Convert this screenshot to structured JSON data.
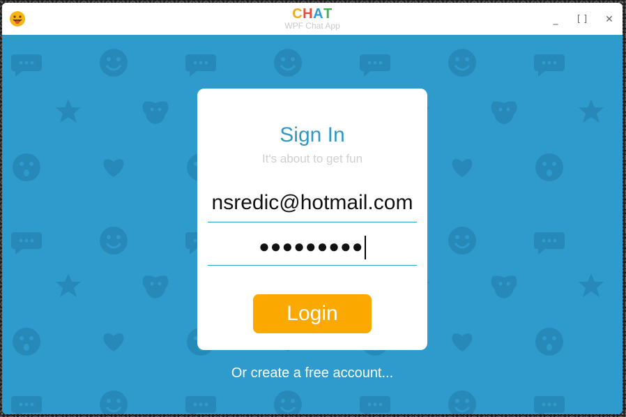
{
  "window": {
    "title_letters": [
      {
        "ch": "C",
        "color": "#f4a81d"
      },
      {
        "ch": "H",
        "color": "#e74c3c"
      },
      {
        "ch": "A",
        "color": "#2f9bcc"
      },
      {
        "ch": "T",
        "color": "#3cb44b"
      }
    ],
    "subtitle": "WPF Chat App",
    "controls": {
      "minimize": "_",
      "maximize": "[ ]",
      "close": "✕"
    }
  },
  "login": {
    "heading": "Sign In",
    "subheading": "It's about to get fun",
    "email_value": "nsredic@hotmail.com",
    "password_masked": "●●●●●●●●●",
    "button_label": "Login"
  },
  "footer": {
    "create_account_label": "Or create a free account..."
  },
  "colors": {
    "background": "#2f9bcc",
    "pattern": "#2789b8",
    "accent": "#3399c2",
    "button": "#fba800"
  },
  "icons": [
    "smiley-app-icon",
    "chat-bubble-icon",
    "smiley-icon",
    "star-icon",
    "dog-icon",
    "heart-icon",
    "surprised-icon"
  ]
}
